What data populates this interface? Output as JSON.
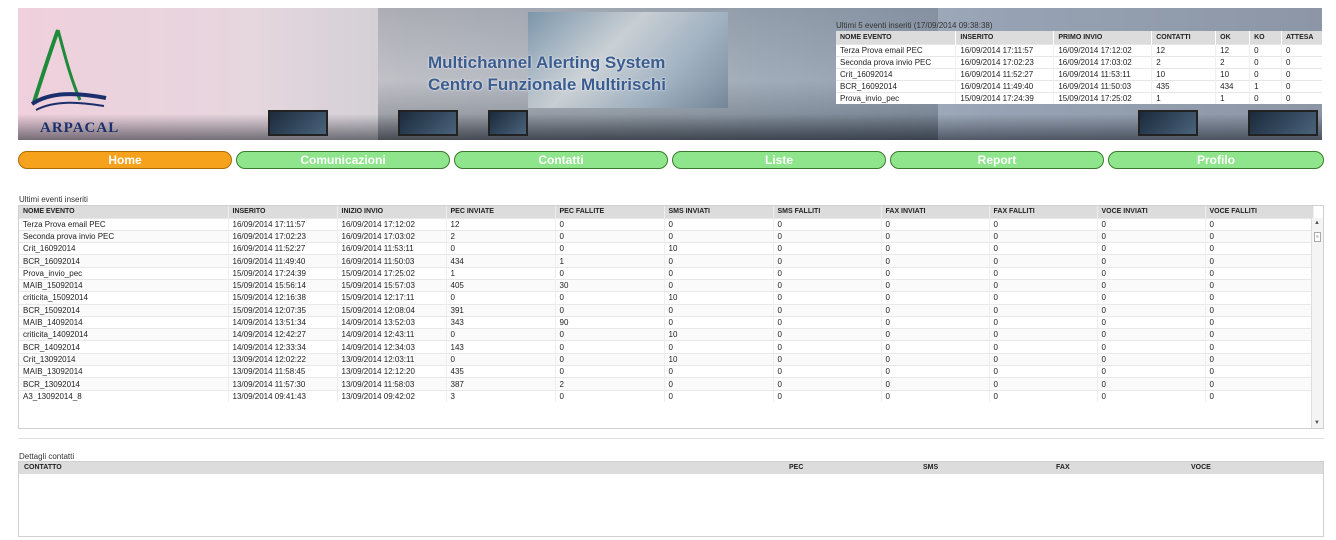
{
  "banner": {
    "logo_text": "ARPACAL",
    "title_line1": "Multichannel Alerting System",
    "title_line2": "Centro Funzionale Multirischi",
    "recent_caption": "Ultimi 5 eventi inseriti (17/09/2014 09:38:38)",
    "recent_columns": [
      "NOME EVENTO",
      "INSERITO",
      "PRIMO INVIO",
      "CONTATTI",
      "OK",
      "KO",
      "ATTESA"
    ],
    "recent_rows": [
      [
        "Terza Prova email PEC",
        "16/09/2014 17:11:57",
        "16/09/2014 17:12:02",
        "12",
        "12",
        "0",
        "0"
      ],
      [
        "Seconda prova invio PEC",
        "16/09/2014 17:02:23",
        "16/09/2014 17:03:02",
        "2",
        "2",
        "0",
        "0"
      ],
      [
        "Crit_16092014",
        "16/09/2014 11:52:27",
        "16/09/2014 11:53:11",
        "10",
        "10",
        "0",
        "0"
      ],
      [
        "BCR_16092014",
        "16/09/2014 11:49:40",
        "16/09/2014 11:50:03",
        "435",
        "434",
        "1",
        "0"
      ],
      [
        "Prova_invio_pec",
        "15/09/2014 17:24:39",
        "15/09/2014 17:25:02",
        "1",
        "1",
        "0",
        "0"
      ]
    ]
  },
  "nav": {
    "items": [
      "Home",
      "Comunicazioni",
      "Contatti",
      "Liste",
      "Report",
      "Profilo"
    ],
    "active": "Home",
    "active_color": "#f6a21d",
    "inactive_color": "#8fe58c"
  },
  "events": {
    "label": "Ultimi eventi inseriti",
    "columns": [
      "NOME EVENTO",
      "INSERITO",
      "INIZIO INVIO",
      "PEC INVIATE",
      "PEC FALLITE",
      "SMS INVIATI",
      "SMS FALLITI",
      "FAX INVIATI",
      "FAX FALLITI",
      "VOCE INVIATI",
      "VOCE FALLITI"
    ],
    "rows": [
      [
        "Terza Prova email PEC",
        "16/09/2014 17:11:57",
        "16/09/2014 17:12:02",
        "12",
        "0",
        "0",
        "0",
        "0",
        "0",
        "0",
        "0"
      ],
      [
        "Seconda prova invio PEC",
        "16/09/2014 17:02:23",
        "16/09/2014 17:03:02",
        "2",
        "0",
        "0",
        "0",
        "0",
        "0",
        "0",
        "0"
      ],
      [
        "Crit_16092014",
        "16/09/2014 11:52:27",
        "16/09/2014 11:53:11",
        "0",
        "0",
        "10",
        "0",
        "0",
        "0",
        "0",
        "0"
      ],
      [
        "BCR_16092014",
        "16/09/2014 11:49:40",
        "16/09/2014 11:50:03",
        "434",
        "1",
        "0",
        "0",
        "0",
        "0",
        "0",
        "0"
      ],
      [
        "Prova_invio_pec",
        "15/09/2014 17:24:39",
        "15/09/2014 17:25:02",
        "1",
        "0",
        "0",
        "0",
        "0",
        "0",
        "0",
        "0"
      ],
      [
        "MAIB_15092014",
        "15/09/2014 15:56:14",
        "15/09/2014 15:57:03",
        "405",
        "30",
        "0",
        "0",
        "0",
        "0",
        "0",
        "0"
      ],
      [
        "criticita_15092014",
        "15/09/2014 12:16:38",
        "15/09/2014 12:17:11",
        "0",
        "0",
        "10",
        "0",
        "0",
        "0",
        "0",
        "0"
      ],
      [
        "BCR_15092014",
        "15/09/2014 12:07:35",
        "15/09/2014 12:08:04",
        "391",
        "0",
        "0",
        "0",
        "0",
        "0",
        "0",
        "0"
      ],
      [
        "MAIB_14092014",
        "14/09/2014 13:51:34",
        "14/09/2014 13:52:03",
        "343",
        "90",
        "0",
        "0",
        "0",
        "0",
        "0",
        "0"
      ],
      [
        "criticita_14092014",
        "14/09/2014 12:42:27",
        "14/09/2014 12:43:11",
        "0",
        "0",
        "10",
        "0",
        "0",
        "0",
        "0",
        "0"
      ],
      [
        "BCR_14092014",
        "14/09/2014 12:33:34",
        "14/09/2014 12:34:03",
        "143",
        "0",
        "0",
        "0",
        "0",
        "0",
        "0",
        "0"
      ],
      [
        "Crit_13092014",
        "13/09/2014 12:02:22",
        "13/09/2014 12:03:11",
        "0",
        "0",
        "10",
        "0",
        "0",
        "0",
        "0",
        "0"
      ],
      [
        "MAIB_13092014",
        "13/09/2014 11:58:45",
        "13/09/2014 12:12:20",
        "435",
        "0",
        "0",
        "0",
        "0",
        "0",
        "0",
        "0"
      ],
      [
        "BCR_13092014",
        "13/09/2014 11:57:30",
        "13/09/2014 11:58:03",
        "387",
        "2",
        "0",
        "0",
        "0",
        "0",
        "0",
        "0"
      ],
      [
        "A3_13092014_8",
        "13/09/2014 09:41:43",
        "13/09/2014 09:42:02",
        "3",
        "0",
        "0",
        "0",
        "0",
        "0",
        "0",
        "0"
      ]
    ]
  },
  "contacts": {
    "label": "Dettagli contatti",
    "columns": [
      "CONTATTO",
      "PEC",
      "SMS",
      "FAX",
      "VOCE"
    ]
  }
}
